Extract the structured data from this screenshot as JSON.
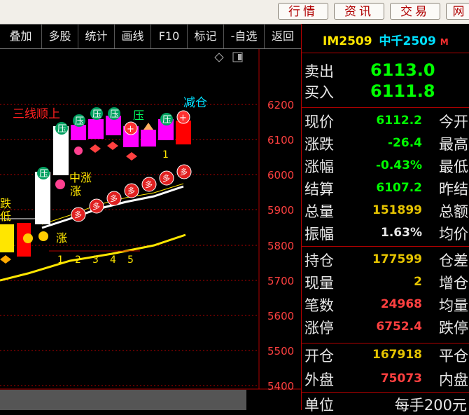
{
  "top_tabs": [
    "行情",
    "资讯",
    "交易",
    "网"
  ],
  "menu": [
    "叠加",
    "多股",
    "统计",
    "画线",
    "F10",
    "标记",
    "-自选",
    "返回"
  ],
  "quote": {
    "code": "IM2509",
    "name": "中千2509",
    "flag": "M",
    "sell_label": "卖出",
    "sell_value": "6113.0",
    "buy_label": "买入",
    "buy_value": "6111.8",
    "rows1": [
      {
        "label": "现价",
        "value": "6112.2",
        "label2": "今开",
        "color": "#00ff00"
      },
      {
        "label": "涨跌",
        "value": "-26.4",
        "label2": "最高",
        "color": "#00ff00"
      },
      {
        "label": "涨幅",
        "value": "-0.43%",
        "label2": "最低",
        "color": "#00ff00"
      },
      {
        "label": "结算",
        "value": "6107.2",
        "label2": "昨结",
        "color": "#00ff00"
      },
      {
        "label": "总量",
        "value": "151899",
        "label2": "总额",
        "color": "#e6c400"
      },
      {
        "label": "振幅",
        "value": "1.63%",
        "label2": "均价",
        "color": "#e6e6e6"
      }
    ],
    "rows2": [
      {
        "label": "持仓",
        "value": "177599",
        "label2": "仓差",
        "color": "#e6c400"
      },
      {
        "label": "现量",
        "value": "2",
        "label2": "增仓",
        "color": "#e6c400"
      },
      {
        "label": "笔数",
        "value": "24968",
        "label2": "均量",
        "color": "#ff4040"
      },
      {
        "label": "涨停",
        "value": "6752.4",
        "label2": "跌停",
        "color": "#ff4040"
      }
    ],
    "rows3": [
      {
        "label": "开仓",
        "value": "167918",
        "label2": "平仓",
        "color": "#e6c400"
      },
      {
        "label": "外盘",
        "value": "75073",
        "label2": "内盘",
        "color": "#ff4040"
      }
    ],
    "unit_label": "单位",
    "unit_value": "每手200元"
  },
  "chart": {
    "price_ticks": [
      "6200",
      "6100",
      "6000",
      "5900",
      "5800",
      "5700",
      "5600",
      "5500",
      "5400"
    ],
    "annotations": {
      "three_lines": "三线顺上",
      "reduce": "减仓",
      "mid_rise": "中涨",
      "rise": "涨",
      "rise2": "涨",
      "fall": "跌",
      "low": "低",
      "press": "压"
    },
    "count_labels": [
      "1",
      "2",
      "3",
      "4",
      "5",
      "1"
    ],
    "buy_marker": "多",
    "colors": {
      "up": "#ff0000",
      "down": "#00ff00",
      "accent": "#e6c400",
      "pink": "#ff00ff"
    }
  }
}
